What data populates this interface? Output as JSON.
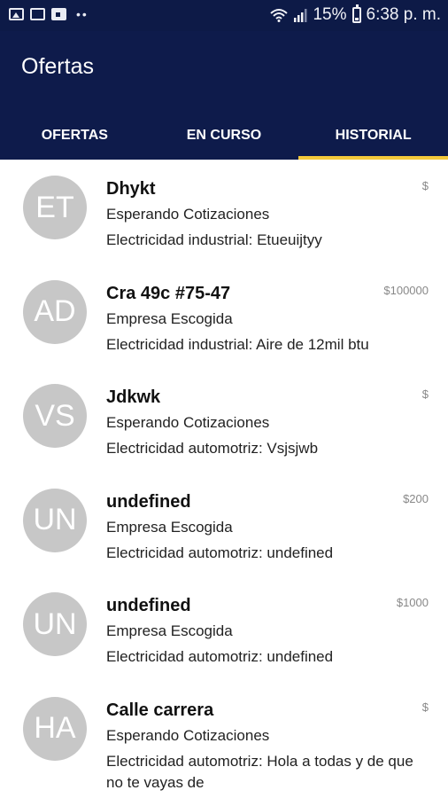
{
  "statusbar": {
    "icons": [
      "image-icon",
      "activity-icon",
      "flipboard-icon"
    ],
    "overflow_dots": "••",
    "battery": "15%",
    "time": "6:38 p. m."
  },
  "appbar": {
    "title": "Ofertas",
    "tabs": [
      {
        "label": "OFERTAS",
        "active": false
      },
      {
        "label": "EN CURSO",
        "active": false
      },
      {
        "label": "HISTORIAL",
        "active": true
      }
    ]
  },
  "items": [
    {
      "initials": "ET",
      "title": "Dhykt",
      "status": "Esperando Cotizaciones",
      "description": "Electricidad industrial: Etueuijtyy",
      "price": "$"
    },
    {
      "initials": "AD",
      "title": "Cra 49c #75-47",
      "status": "Empresa Escogida",
      "description": "Electricidad industrial: Aire de 12mil btu",
      "price": "$100000"
    },
    {
      "initials": "VS",
      "title": "Jdkwk",
      "status": "Esperando Cotizaciones",
      "description": "Electricidad automotriz: Vsjsjwb",
      "price": "$"
    },
    {
      "initials": "UN",
      "title": "undefined",
      "status": "Empresa Escogida",
      "description": "Electricidad automotriz: undefined",
      "price": "$200"
    },
    {
      "initials": "UN",
      "title": "undefined",
      "status": "Empresa Escogida",
      "description": "Electricidad automotriz: undefined",
      "price": "$1000"
    },
    {
      "initials": "HA",
      "title": "Calle carrera",
      "status": "Esperando Cotizaciones",
      "description": "Electricidad automotriz: Hola a todas y de que no te vayas de",
      "price": "$"
    }
  ],
  "colors": {
    "appbar": "#0e1b4b",
    "tab_indicator": "#f4c93a",
    "avatar": "#c7c7c7"
  }
}
